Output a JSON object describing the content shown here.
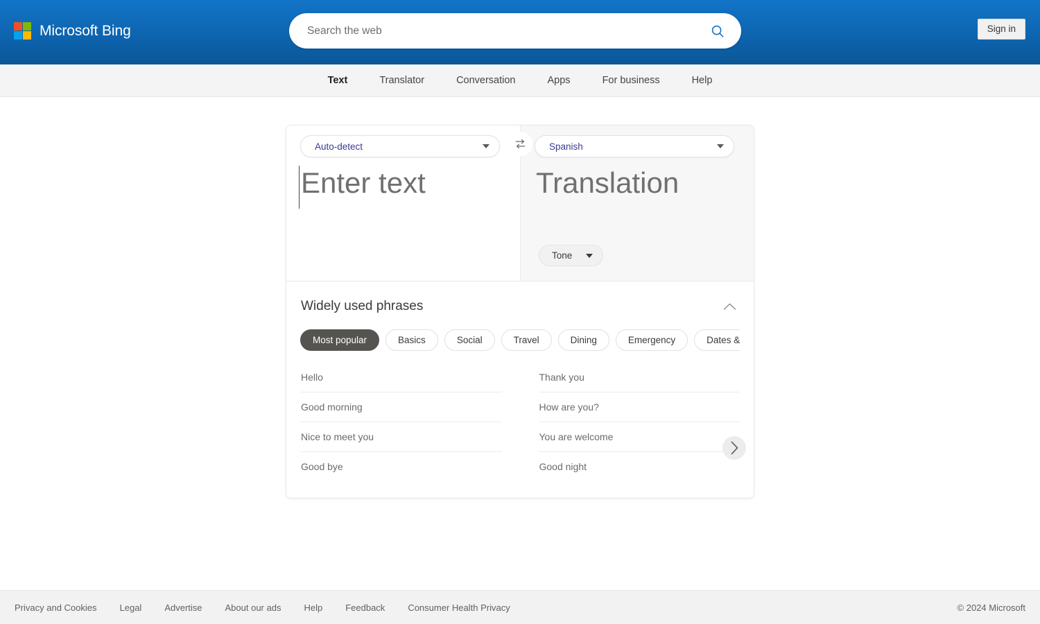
{
  "header": {
    "brand": "Microsoft Bing",
    "logo_colors": {
      "red": "#f25022",
      "green": "#7fba00",
      "blue": "#00a4ef",
      "yellow": "#ffb900"
    },
    "background_color": "#0d63ad",
    "search": {
      "placeholder": "Search the web",
      "value": "",
      "icon": "search-icon"
    },
    "sign_in_label": "Sign in"
  },
  "nav": {
    "items": [
      {
        "label": "Text",
        "active": true
      },
      {
        "label": "Translator",
        "active": false
      },
      {
        "label": "Conversation",
        "active": false
      },
      {
        "label": "Apps",
        "active": false
      },
      {
        "label": "For business",
        "active": false
      },
      {
        "label": "Help",
        "active": false
      }
    ]
  },
  "translator": {
    "source": {
      "language": "Auto-detect",
      "text": "",
      "placeholder": "Enter text"
    },
    "target": {
      "language": "Spanish",
      "text": "",
      "placeholder": "Translation",
      "tone_label": "Tone"
    },
    "swap_icon": "swap-languages-icon",
    "language_text_color": "#3b3a8f"
  },
  "phrases": {
    "title": "Widely used phrases",
    "collapse_icon": "chevron-up-icon",
    "next_icon": "chevron-right-icon",
    "categories": [
      {
        "label": "Most popular",
        "active": true
      },
      {
        "label": "Basics",
        "active": false
      },
      {
        "label": "Social",
        "active": false
      },
      {
        "label": "Travel",
        "active": false
      },
      {
        "label": "Dining",
        "active": false
      },
      {
        "label": "Emergency",
        "active": false
      },
      {
        "label": "Dates & numbers",
        "active": false
      }
    ],
    "active_pill_color": "#565450",
    "items": [
      "Hello",
      "Thank you",
      "Good morning",
      "How are you?",
      "Nice to meet you",
      "You are welcome",
      "Good bye",
      "Good night"
    ]
  },
  "footer": {
    "links": [
      "Privacy and Cookies",
      "Legal",
      "Advertise",
      "About our ads",
      "Help",
      "Feedback",
      "Consumer Health Privacy"
    ],
    "copyright": "© 2024 Microsoft"
  }
}
